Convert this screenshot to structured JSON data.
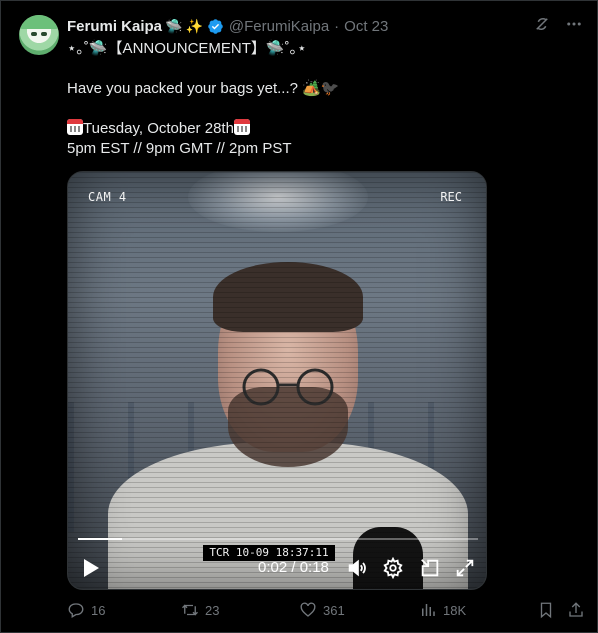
{
  "post": {
    "display_name": "Ferumi Kaipa",
    "name_emojis": [
      "🛸",
      "✨"
    ],
    "handle": "@FerumiKaipa",
    "separator": "·",
    "date": "Oct 23",
    "line1": "⋆｡˚🛸【ANNOUNCEMENT】🛸˚｡⋆",
    "line2": "Have you packed your bags yet...? 🏕️🐦‍⬛",
    "line3": "Tuesday, October 28th",
    "line4": "5pm EST // 9pm GMT // 2pm PST"
  },
  "video": {
    "cam_label": "CAM 4",
    "rec_label": "REC",
    "tcr_label": "TCR 10-09 18:37:11",
    "time": "0:02 / 0:18",
    "progress": 0.11
  },
  "actions": {
    "replies": "16",
    "reposts": "23",
    "likes": "361",
    "views": "18K"
  },
  "icons": {
    "verified": "verified-badge-icon",
    "grok": "grok-icon",
    "more": "more-icon"
  },
  "colors": {
    "background": "#000000",
    "text": "#e7e9ea",
    "muted": "#71767b",
    "verified": "#1d9bf0"
  }
}
